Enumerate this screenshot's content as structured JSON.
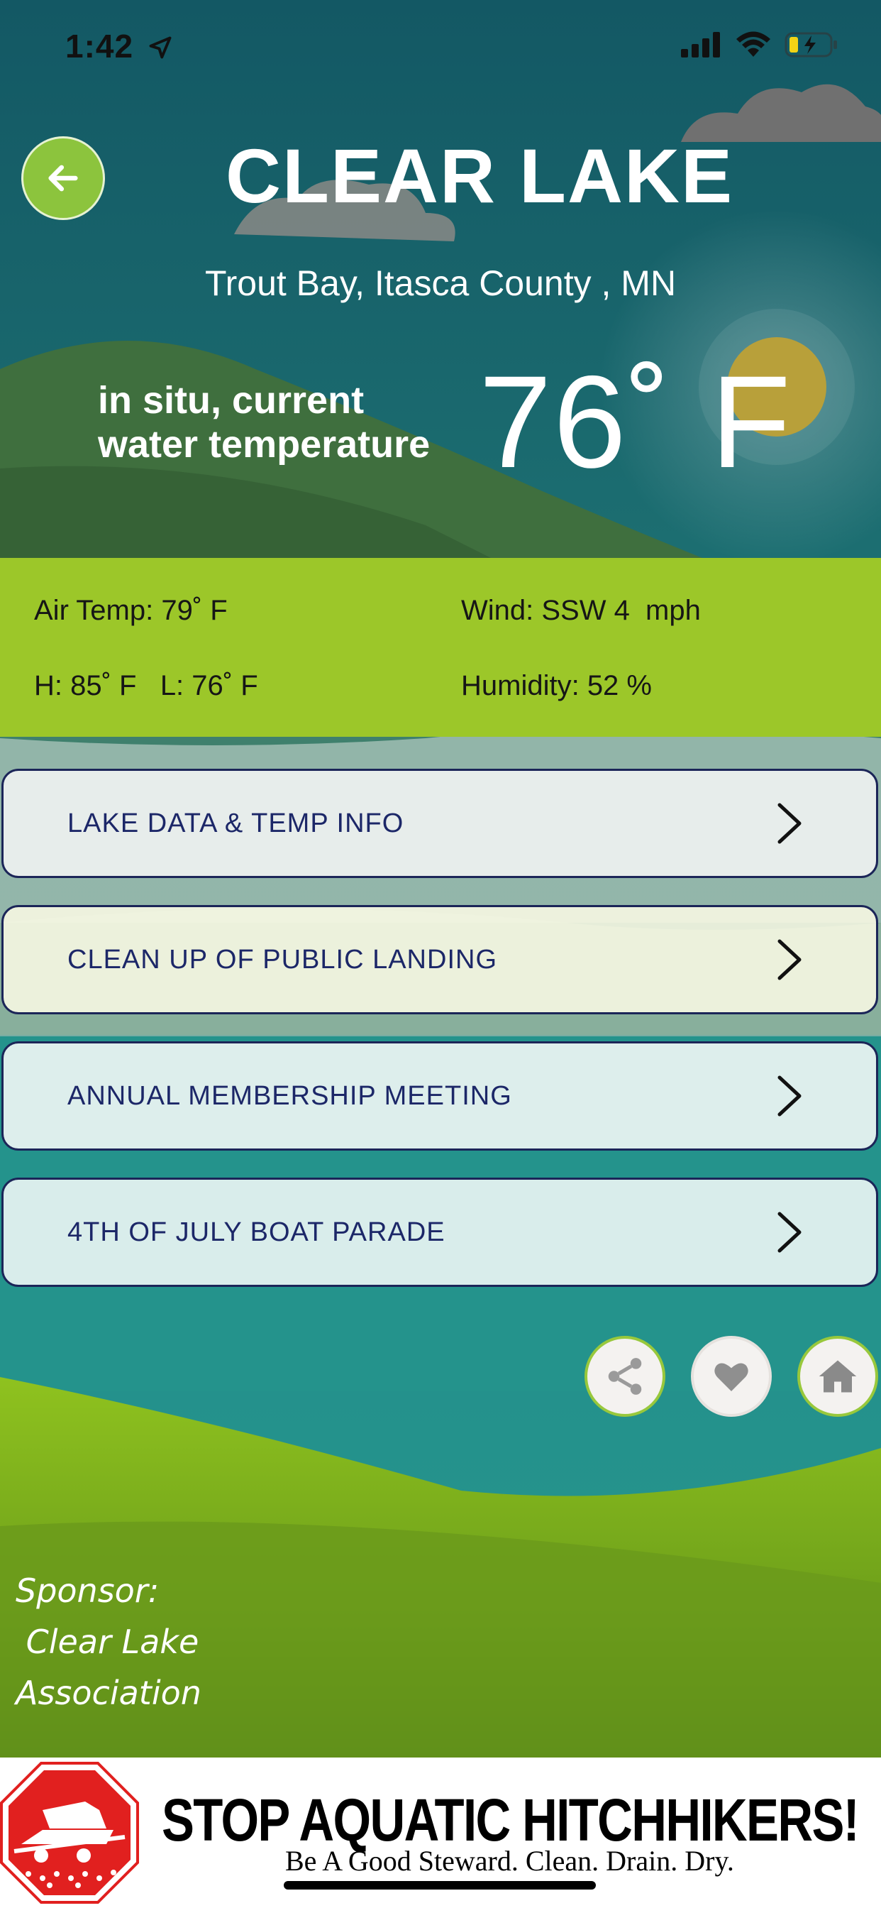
{
  "status_bar": {
    "time": "1:42",
    "icons": [
      "location-arrow-icon",
      "signal-icon",
      "wifi-icon",
      "battery-charging-icon"
    ]
  },
  "header": {
    "back_icon": "arrow-left-icon",
    "title": "CLEAR LAKE",
    "location": "Trout Bay, Itasca County , MN"
  },
  "current": {
    "label_line1": "in situ, current",
    "label_line2": "water temperature",
    "value": "76˚ F"
  },
  "weather": {
    "air_temp": "Air Temp: 79˚ F",
    "wind": "Wind: SSW 4  mph",
    "high_low": "H: 85˚ F   L: 76˚ F",
    "humidity": "Humidity: 52 %"
  },
  "menu": [
    {
      "label": "LAKE DATA & TEMP INFO"
    },
    {
      "label": "CLEAN UP OF PUBLIC LANDING"
    },
    {
      "label": "ANNUAL MEMBERSHIP MEETING"
    },
    {
      "label": "4TH OF JULY BOAT PARADE"
    }
  ],
  "actions": [
    "share-icon",
    "heart-icon",
    "home-icon"
  ],
  "sponsor": {
    "line1": "Sponsor:",
    "line2": " Clear Lake",
    "line3": "Association"
  },
  "banner": {
    "title": "STOP AQUATIC HITCHHIKERS!",
    "subtitle": "Be A Good Steward. Clean. Drain. Dry."
  },
  "colors": {
    "accent_green": "#9cc729",
    "button_text": "#1c2768",
    "sky_teal": "#1d6f74"
  }
}
